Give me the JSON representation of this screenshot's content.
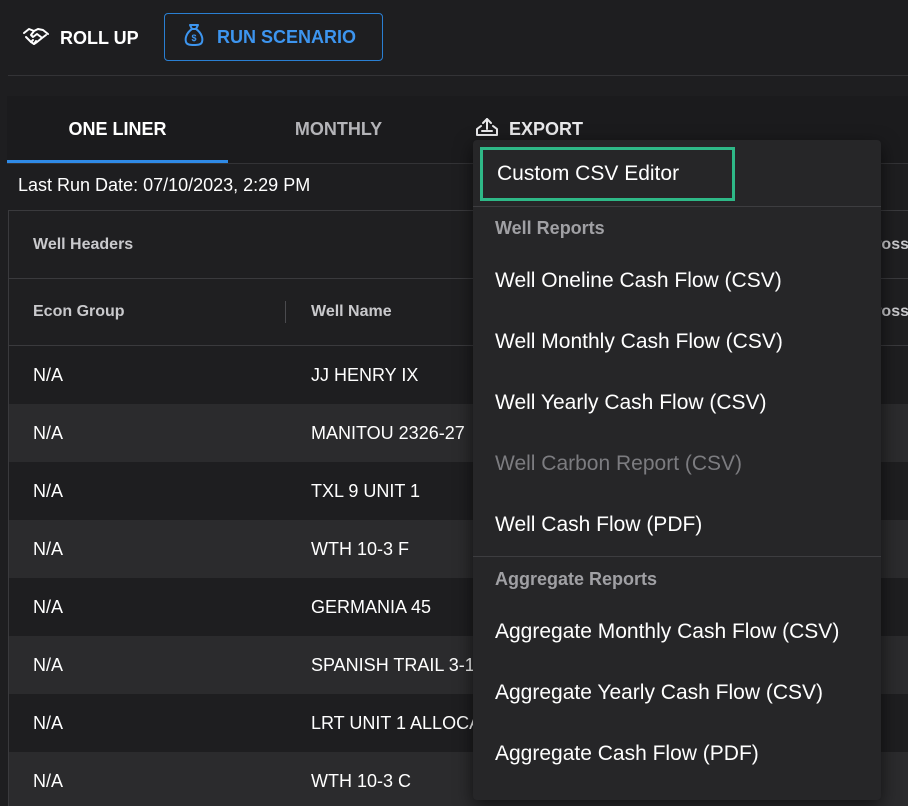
{
  "toolbar": {
    "rollup_label": "ROLL UP",
    "run_scenario_label": "RUN SCENARIO"
  },
  "tabs": {
    "one_liner": "ONE LINER",
    "monthly": "MONTHLY",
    "export": "EXPORT"
  },
  "last_run": "Last Run Date: 07/10/2023, 2:29 PM",
  "table": {
    "group_header": "Well Headers",
    "group_header_partial": "ross",
    "columns": {
      "econ_group": "Econ Group",
      "well_name": "Well Name",
      "partial": "ross"
    },
    "rows": [
      {
        "econ": "N/A",
        "well": "JJ HENRY IX"
      },
      {
        "econ": "N/A",
        "well": "MANITOU 2326-27"
      },
      {
        "econ": "N/A",
        "well": "TXL 9 UNIT 1"
      },
      {
        "econ": "N/A",
        "well": "WTH 10-3 F"
      },
      {
        "econ": "N/A",
        "well": "GERMANIA 45"
      },
      {
        "econ": "N/A",
        "well": "SPANISH TRAIL 3-1"
      },
      {
        "econ": "N/A",
        "well": "LRT UNIT 1 ALLOCA"
      },
      {
        "econ": "N/A",
        "well": "WTH 10-3 C"
      }
    ]
  },
  "export_menu": {
    "custom_csv": "Custom CSV Editor",
    "well_section": "Well Reports",
    "well_items": [
      {
        "label": "Well Oneline Cash Flow (CSV)",
        "disabled": false
      },
      {
        "label": "Well Monthly Cash Flow (CSV)",
        "disabled": false
      },
      {
        "label": "Well Yearly Cash Flow (CSV)",
        "disabled": false
      },
      {
        "label": "Well Carbon Report (CSV)",
        "disabled": true
      },
      {
        "label": "Well Cash Flow (PDF)",
        "disabled": false
      }
    ],
    "aggregate_section": "Aggregate Reports",
    "aggregate_items": [
      {
        "label": "Aggregate Monthly Cash Flow (CSV)"
      },
      {
        "label": "Aggregate Yearly Cash Flow (CSV)"
      },
      {
        "label": "Aggregate Cash Flow (PDF)"
      }
    ]
  },
  "colors": {
    "accent_blue": "#2f8ae6",
    "highlight_green": "#2eb887",
    "background": "#1e1e20"
  }
}
